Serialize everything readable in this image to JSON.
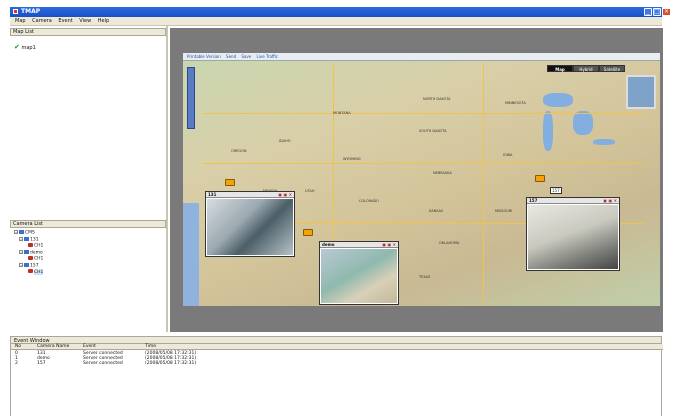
{
  "app": {
    "title": "TMAP"
  },
  "menu": [
    "Map",
    "Camera",
    "Event",
    "View",
    "Help"
  ],
  "map_list": {
    "header": "Map List",
    "items": [
      {
        "label": "map1",
        "checked": true
      }
    ]
  },
  "camera_list": {
    "header": "Camera List",
    "tree": [
      {
        "label": "CMS",
        "level": 0,
        "type": "group"
      },
      {
        "label": "131",
        "level": 1,
        "type": "group"
      },
      {
        "label": "CH1",
        "level": 2,
        "type": "camera"
      },
      {
        "label": "demo",
        "level": 1,
        "type": "group"
      },
      {
        "label": "CH1",
        "level": 2,
        "type": "camera"
      },
      {
        "label": "157",
        "level": 1,
        "type": "group"
      },
      {
        "label": "CH1",
        "level": 2,
        "type": "camera"
      }
    ]
  },
  "map_toolbar": [
    "Printable Version",
    "Send",
    "Save",
    "Live Traffic"
  ],
  "map_types": [
    "Map",
    "Hybrid",
    "Satellite"
  ],
  "map_labels": [
    "MONTANA",
    "NORTH DAKOTA",
    "MINNESOTA",
    "SOUTH DAKOTA",
    "WYOMING",
    "NEBRASKA",
    "IOWA",
    "OREGON",
    "IDAHO",
    "NEVADA",
    "UTAH",
    "KANSAS",
    "MISSOURI",
    "OKLAHOMA",
    "TEXAS",
    "COLORADO"
  ],
  "popups": [
    {
      "name": "131",
      "buttons": "▣ ▣ ×"
    },
    {
      "name": "demo",
      "buttons": "▣ ▣ ×"
    },
    {
      "name": "157",
      "buttons": "▣ ▣ ×"
    }
  ],
  "marker_label": "157",
  "event_window": {
    "header": "Event Window",
    "columns": [
      "No",
      "Camera Name",
      "Event",
      "Time"
    ],
    "rows": [
      {
        "no": "0",
        "camera": "131",
        "event": "Server connected",
        "time": "(2008/05/08 17:32:31)"
      },
      {
        "no": "1",
        "camera": "demo",
        "event": "Server connected",
        "time": "(2008/05/08 17:32:31)"
      },
      {
        "no": "2",
        "camera": "157",
        "event": "Server connected",
        "time": "(2008/05/08 17:32:31)"
      }
    ]
  },
  "colors": {
    "titlebar": "#1a4fc4",
    "map_frame": "#7a7a7a",
    "marker": "#f5a10a"
  }
}
